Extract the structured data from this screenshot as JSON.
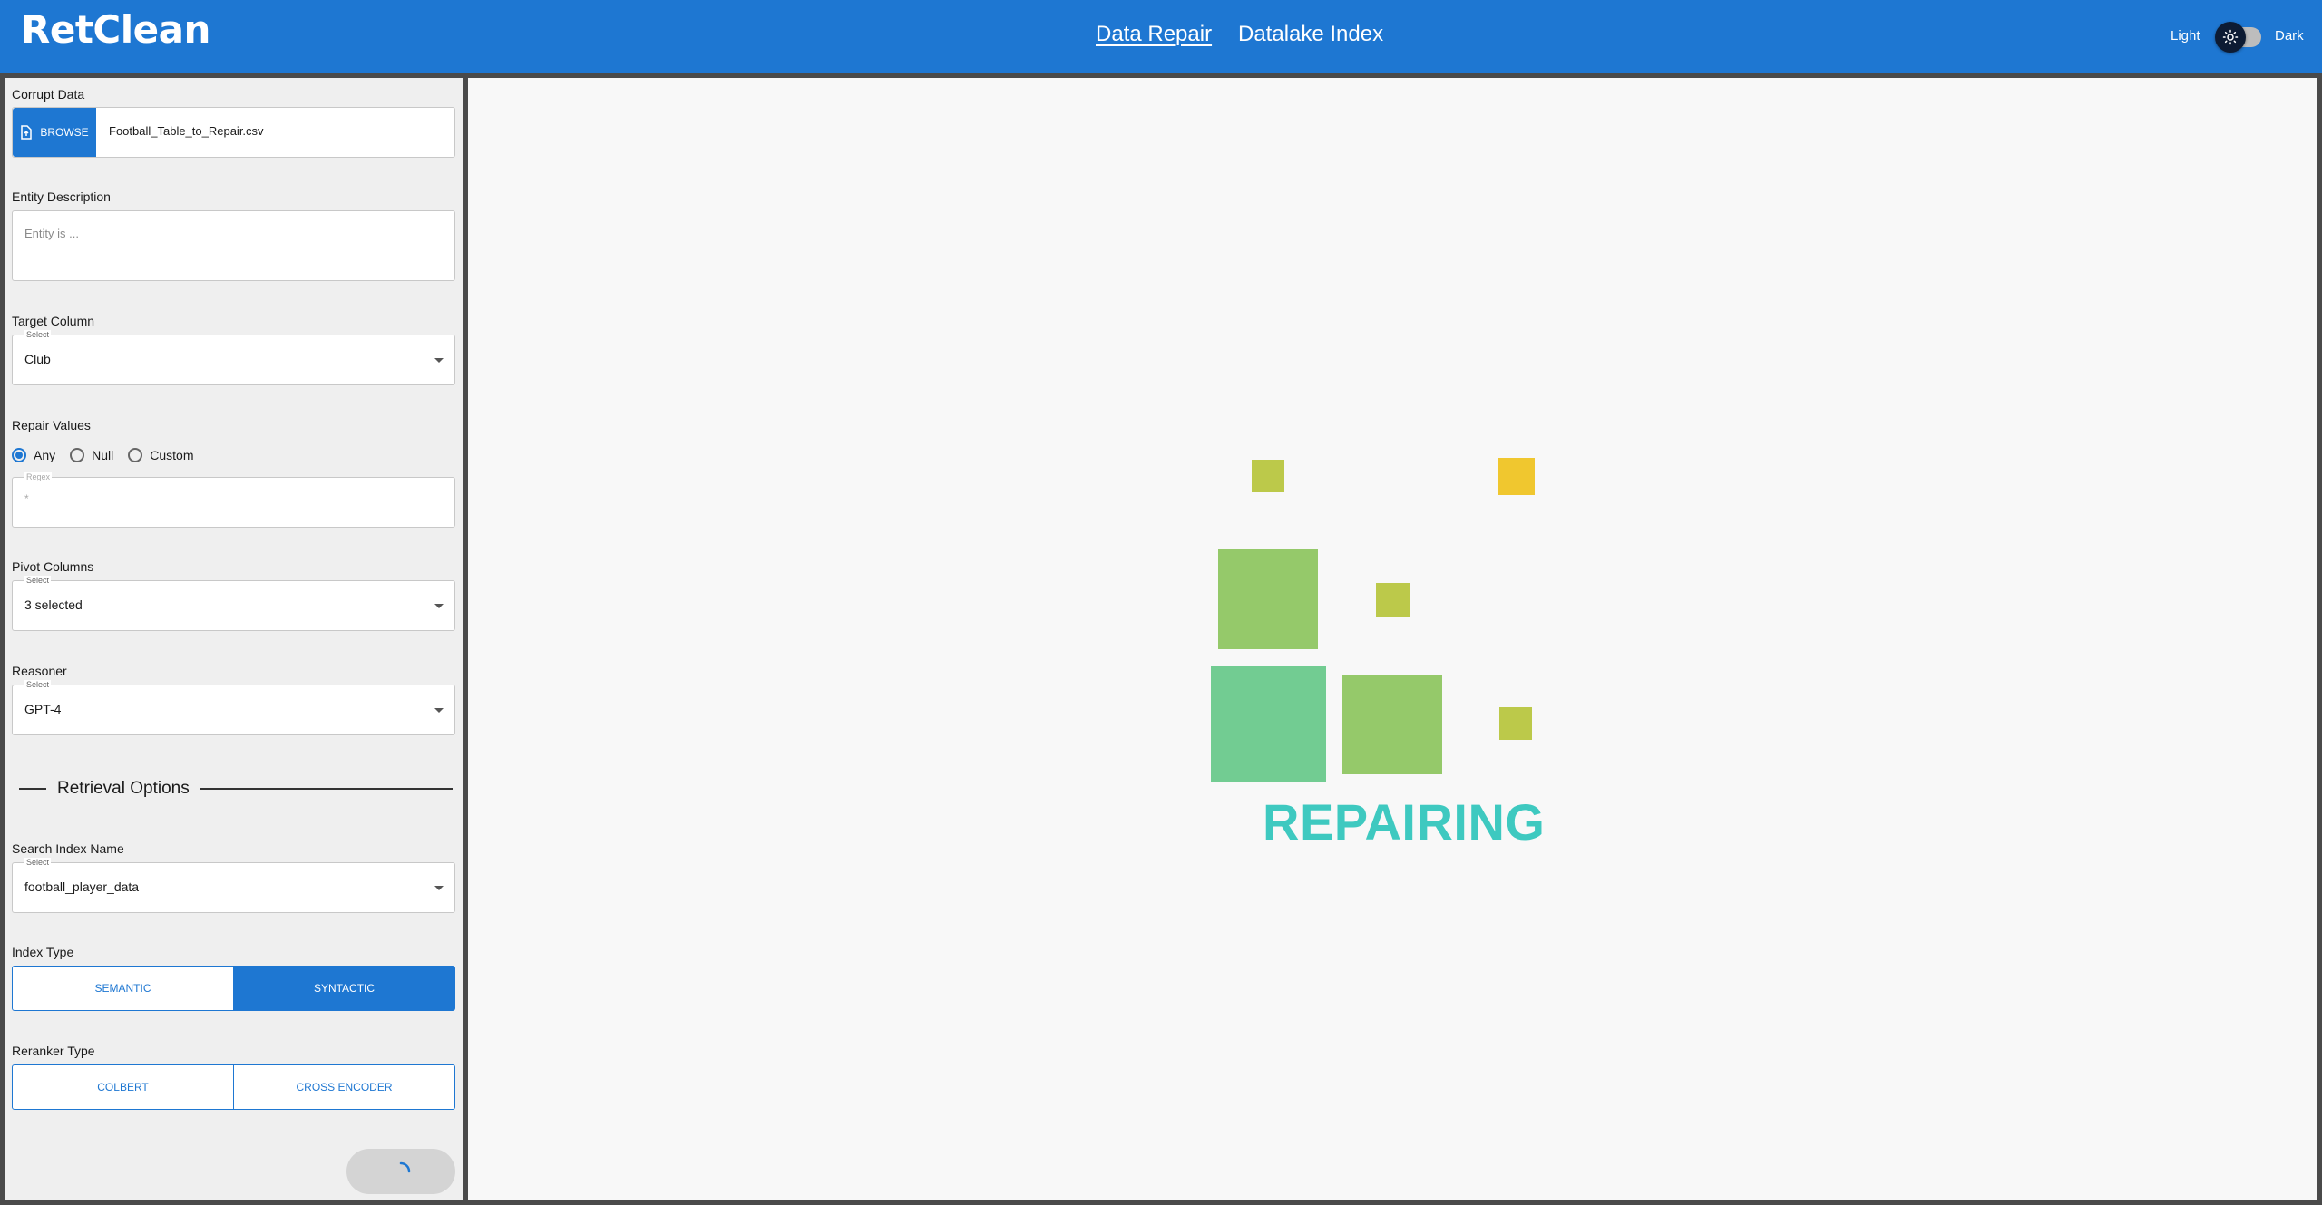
{
  "header": {
    "logo": "RetClean",
    "nav": [
      {
        "label": "Data Repair",
        "active": true
      },
      {
        "label": "Datalake Index",
        "active": false
      }
    ],
    "theme": {
      "light_label": "Light",
      "dark_label": "Dark",
      "icon": "sun-icon"
    }
  },
  "sidebar": {
    "corrupt_data": {
      "label": "Corrupt Data",
      "browse_label": "BROWSE",
      "browse_icon": "file-upload-icon",
      "file_name": "Football_Table_to_Repair.csv"
    },
    "entity_description": {
      "label": "Entity Description",
      "placeholder": "Entity is ..."
    },
    "target_column": {
      "label": "Target Column",
      "select_tag": "Select",
      "value": "Club"
    },
    "repair_values": {
      "label": "Repair Values",
      "options": [
        {
          "label": "Any",
          "checked": true
        },
        {
          "label": "Null",
          "checked": false
        },
        {
          "label": "Custom",
          "checked": false
        }
      ],
      "regex_tag": "Regex",
      "regex_value": "*"
    },
    "pivot_columns": {
      "label": "Pivot Columns",
      "select_tag": "Select",
      "value": "3 selected"
    },
    "reasoner": {
      "label": "Reasoner",
      "select_tag": "Select",
      "value": "GPT-4"
    },
    "retrieval_options_title": "Retrieval Options",
    "search_index": {
      "label": "Search Index Name",
      "select_tag": "Select",
      "value": "football_player_data"
    },
    "index_type": {
      "label": "Index Type",
      "options": [
        {
          "label": "SEMANTIC",
          "active": false
        },
        {
          "label": "SYNTACTIC",
          "active": true
        }
      ]
    },
    "reranker_type": {
      "label": "Reranker Type",
      "options": [
        {
          "label": "COLBERT",
          "active": false
        },
        {
          "label": "CROSS ENCODER",
          "active": false
        }
      ]
    }
  },
  "main": {
    "status_text": "REPAIRING",
    "colors": {
      "accent": "#1e77d2",
      "status_text": "#3ec9c0",
      "lime": "#bcc94a",
      "yellow": "#f0c72f",
      "green": "#95c96a",
      "teal_green": "#72cc92"
    }
  }
}
